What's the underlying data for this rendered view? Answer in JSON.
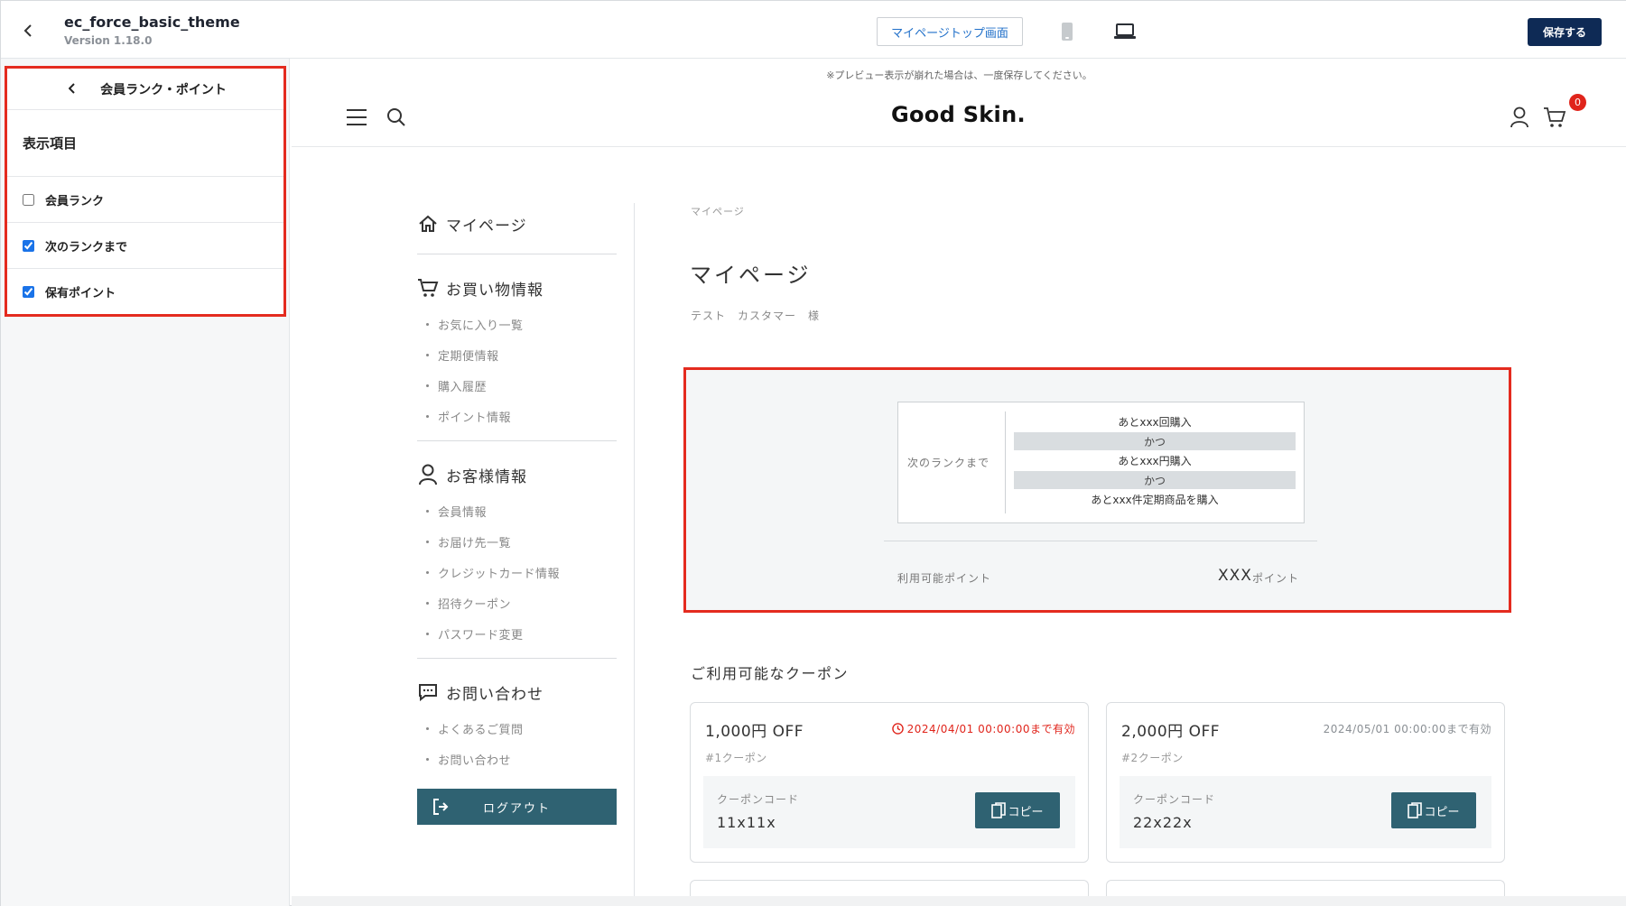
{
  "topbar": {
    "theme_name": "ec_force_basic_theme",
    "version": "Version 1.18.0",
    "preview_tab": "マイページトップ画面",
    "save_label": "保存する"
  },
  "panel": {
    "title": "会員ランク・ポイント",
    "section_title": "表示項目",
    "options": [
      {
        "label": "会員ランク",
        "checked": false
      },
      {
        "label": "次のランクまで",
        "checked": true
      },
      {
        "label": "保有ポイント",
        "checked": true
      }
    ]
  },
  "preview": {
    "notice": "※プレビュー表示が崩れた場合は、一度保存してください。",
    "logo": "Good Skin.",
    "cart_count": "0"
  },
  "nav": {
    "mypage": "マイページ",
    "shopping": {
      "label": "お買い物情報",
      "items": [
        "お気に入り一覧",
        "定期便情報",
        "購入履歴",
        "ポイント情報"
      ]
    },
    "customer": {
      "label": "お客様情報",
      "items": [
        "会員情報",
        "お届け先一覧",
        "クレジットカード情報",
        "招待クーポン",
        "パスワード変更"
      ]
    },
    "contact": {
      "label": "お問い合わせ",
      "items": [
        "よくあるご質問",
        "お問い合わせ"
      ]
    },
    "logout": "ログアウト"
  },
  "main": {
    "breadcrumb": "マイページ",
    "title": "マイページ",
    "customer_name": "テスト　カスタマー　様",
    "rank": {
      "label": "次のランクまで",
      "row1": "あとxxx回購入",
      "and1": "かつ",
      "row2": "あとxxx円購入",
      "and2": "かつ",
      "row3": "あとxxx件定期商品を購入"
    },
    "points": {
      "label": "利用可能ポイント",
      "value": "XXX",
      "unit": "ポイント"
    },
    "coupons_title": "ご利用可能なクーポン",
    "coupons": [
      {
        "amount": "1,000円 OFF",
        "expiry": "2024/04/01 00:00:00まで有効",
        "expiry_color": "#e0241b",
        "name": "#1クーポン",
        "code_label": "クーポンコード",
        "code": "11x11x",
        "copy_label": "コピー"
      },
      {
        "amount": "2,000円 OFF",
        "expiry": "2024/05/01 00:00:00まで有効",
        "expiry_color": "#8a8f94",
        "name": "#2クーポン",
        "code_label": "クーポンコード",
        "code": "22x22x",
        "copy_label": "コピー"
      }
    ]
  },
  "colors": {
    "accent": "#0e2a55",
    "highlight": "#e42b1f",
    "button": "#2f6272"
  }
}
